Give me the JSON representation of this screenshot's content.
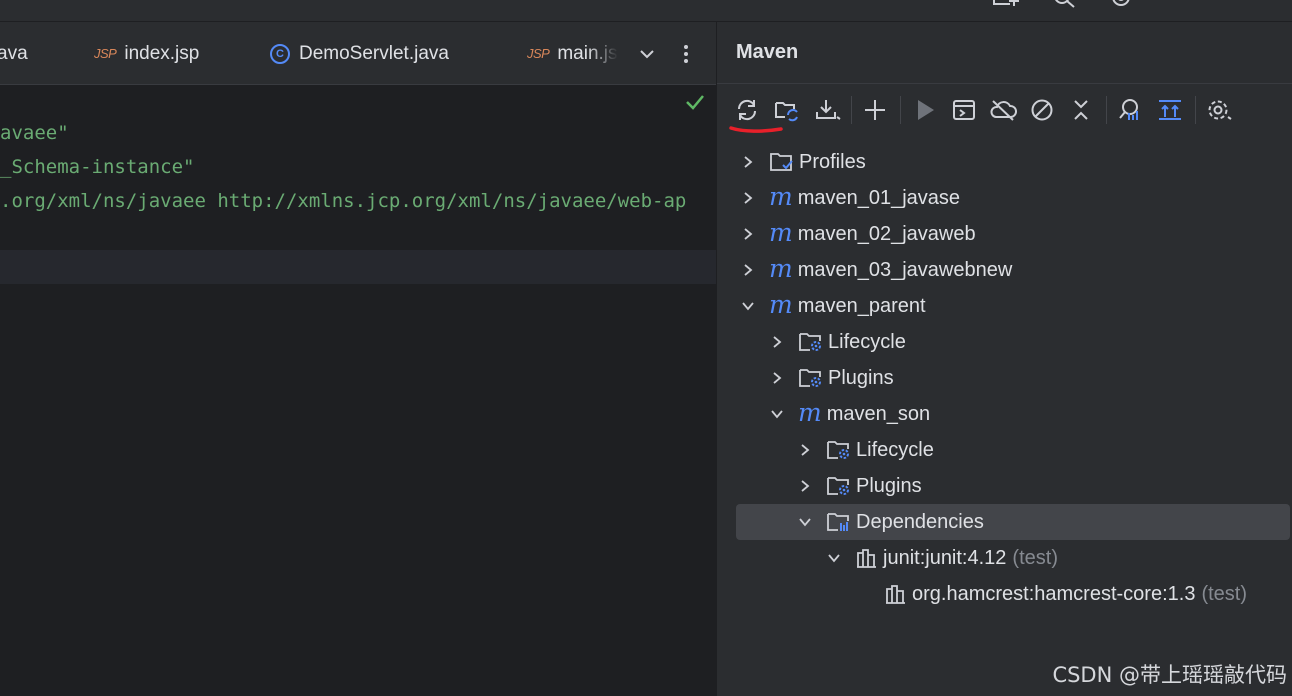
{
  "editor": {
    "tabs": [
      {
        "label": "ava",
        "icon": "java-class-icon"
      },
      {
        "label": "index.jsp",
        "badge": "JSP"
      },
      {
        "label": "DemoServlet.java",
        "badge": "C"
      },
      {
        "label": "main.js",
        "badge": "JSP"
      }
    ],
    "code_lines": [
      "avaee\"",
      "_Schema-instance\"",
      ".org/xml/ns/javaee http://xmlns.jcp.org/xml/ns/javaee/web-ap",
      "",
      ""
    ]
  },
  "maven": {
    "title": "Maven",
    "toolbar": [
      "reload-icon",
      "generate-sources-icon",
      "download-icon",
      "add-icon",
      "run-icon",
      "execute-goal-icon",
      "offline-icon",
      "skip-tests-icon",
      "collapse-all-icon",
      "analyze-dependencies-icon",
      "show-ignored-icon",
      "settings-icon"
    ],
    "tree": [
      {
        "label": "Profiles",
        "type": "folder-profile",
        "level": 0,
        "expanded": false
      },
      {
        "label": "maven_01_javase",
        "type": "module",
        "level": 0,
        "expanded": false
      },
      {
        "label": "maven_02_javaweb",
        "type": "module",
        "level": 0,
        "expanded": false
      },
      {
        "label": "maven_03_javawebnew",
        "type": "module",
        "level": 0,
        "expanded": false
      },
      {
        "label": "maven_parent",
        "type": "module",
        "level": 0,
        "expanded": true
      },
      {
        "label": "Lifecycle",
        "type": "folder-gear",
        "level": 1,
        "expanded": false
      },
      {
        "label": "Plugins",
        "type": "folder-gear",
        "level": 1,
        "expanded": false
      },
      {
        "label": "maven_son",
        "type": "module",
        "level": 1,
        "expanded": true
      },
      {
        "label": "Lifecycle",
        "type": "folder-gear",
        "level": 2,
        "expanded": false
      },
      {
        "label": "Plugins",
        "type": "folder-gear",
        "level": 2,
        "expanded": false
      },
      {
        "label": "Dependencies",
        "type": "folder-deps",
        "level": 2,
        "expanded": true,
        "selected": true
      },
      {
        "label": "junit:junit:4.12",
        "scope": "(test)",
        "type": "library",
        "level": 3,
        "expanded": true
      },
      {
        "label": "org.hamcrest:hamcrest-core:1.3",
        "scope": "(test)",
        "type": "library",
        "level": 4,
        "leaf": true
      }
    ]
  },
  "watermark": "CSDN @带上瑶瑶敲代码",
  "colors": {
    "accent": "#548af7",
    "string": "#6aab73",
    "jsp": "#d9875a",
    "annotation_red": "#e8202a",
    "check": "#5fb865"
  }
}
